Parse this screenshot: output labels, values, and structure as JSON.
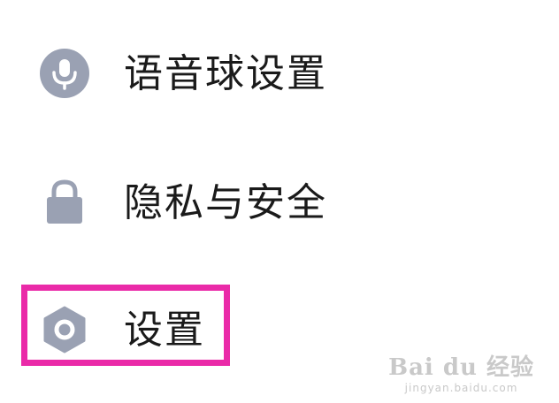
{
  "menu": {
    "items": [
      {
        "label": "语音球设置",
        "icon": "microphone-icon"
      },
      {
        "label": "隐私与安全",
        "icon": "lock-icon"
      },
      {
        "label": "设置",
        "icon": "hexagon-gear-icon"
      }
    ]
  },
  "highlight": {
    "target": "设置",
    "color": "#ea2aa8"
  },
  "watermark": {
    "main": "Bai du 经验",
    "sub": "jingyan.baidu.com"
  },
  "colors": {
    "icon": "#9aa1b3",
    "text": "#1a1a1a",
    "background": "#ffffff"
  }
}
